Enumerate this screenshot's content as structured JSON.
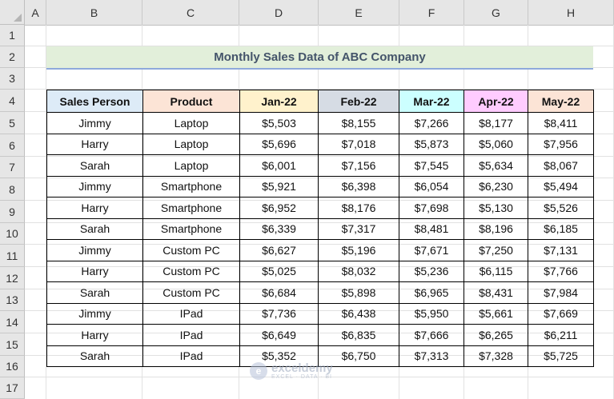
{
  "columns": [
    "A",
    "B",
    "C",
    "D",
    "E",
    "F",
    "G",
    "H"
  ],
  "rows": [
    "1",
    "2",
    "3",
    "4",
    "5",
    "6",
    "7",
    "8",
    "9",
    "10",
    "11",
    "12",
    "13",
    "14",
    "15",
    "16",
    "17"
  ],
  "title": "Monthly Sales Data of ABC Company",
  "headers": [
    "Sales Person",
    "Product",
    "Jan-22",
    "Feb-22",
    "Mar-22",
    "Apr-22",
    "May-22"
  ],
  "header_colors": [
    "#ddebf7",
    "#fce4d6",
    "#fff2cc",
    "#d6dce4",
    "#ccffff",
    "#ffccff",
    "#fce4d6"
  ],
  "table": [
    [
      "Jimmy",
      "Laptop",
      "$5,503",
      "$8,155",
      "$7,266",
      "$8,177",
      "$8,411"
    ],
    [
      "Harry",
      "Laptop",
      "$5,696",
      "$7,018",
      "$5,873",
      "$5,060",
      "$7,956"
    ],
    [
      "Sarah",
      "Laptop",
      "$6,001",
      "$7,156",
      "$7,545",
      "$5,634",
      "$8,067"
    ],
    [
      "Jimmy",
      "Smartphone",
      "$5,921",
      "$6,398",
      "$6,054",
      "$6,230",
      "$5,494"
    ],
    [
      "Harry",
      "Smartphone",
      "$6,952",
      "$8,176",
      "$7,698",
      "$5,130",
      "$5,526"
    ],
    [
      "Sarah",
      "Smartphone",
      "$6,339",
      "$7,317",
      "$8,481",
      "$8,196",
      "$6,185"
    ],
    [
      "Jimmy",
      "Custom PC",
      "$6,627",
      "$5,196",
      "$7,671",
      "$7,250",
      "$7,131"
    ],
    [
      "Harry",
      "Custom PC",
      "$5,025",
      "$8,032",
      "$5,236",
      "$6,115",
      "$7,766"
    ],
    [
      "Sarah",
      "Custom PC",
      "$6,684",
      "$5,898",
      "$6,965",
      "$8,431",
      "$7,984"
    ],
    [
      "Jimmy",
      "IPad",
      "$7,736",
      "$6,438",
      "$5,950",
      "$5,661",
      "$7,669"
    ],
    [
      "Harry",
      "IPad",
      "$6,649",
      "$6,835",
      "$7,666",
      "$6,265",
      "$6,211"
    ],
    [
      "Sarah",
      "IPad",
      "$5,352",
      "$6,750",
      "$7,313",
      "$7,328",
      "$5,725"
    ]
  ],
  "watermark": {
    "name": "exceldemy",
    "tag": "EXCEL · DATA · BI"
  }
}
